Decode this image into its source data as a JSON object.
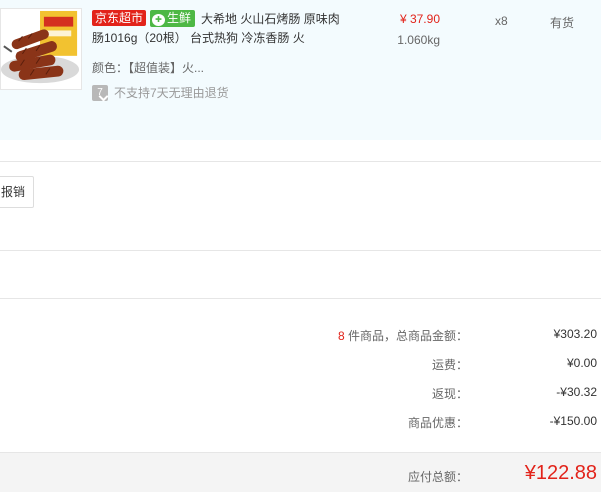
{
  "item": {
    "tag_jd": "京东超市",
    "tag_fresh": "生鲜",
    "title": "大希地 火山石烤肠 原味肉肠1016g（20根） 台式热狗 冷冻香肠 火",
    "price": "¥ 37.90",
    "weight": "1.060kg",
    "quantity": "x8",
    "stock": "有货",
    "color_label": "颜色：",
    "color_value": "【超值装】火...",
    "return_icon_text": "7",
    "return_policy": "不支持7天无理由退货"
  },
  "reimburse_button": "报销",
  "summary": {
    "goods_count": "8",
    "goods_label": " 件商品，总商品金额：",
    "goods_amount": "¥303.20",
    "shipping_label": "运费：",
    "shipping_amount": "¥0.00",
    "cashback_label": "返现：",
    "cashback_amount": "-¥30.32",
    "discount_label": "商品优惠：",
    "discount_amount": "-¥150.00",
    "total_label": "应付总额：",
    "total_amount": "¥122.88"
  },
  "colors": {
    "price_red": "#e2231a",
    "fresh_green": "#4db845",
    "item_bg": "#f3fbfe",
    "total_bg": "#f4f4f4"
  }
}
